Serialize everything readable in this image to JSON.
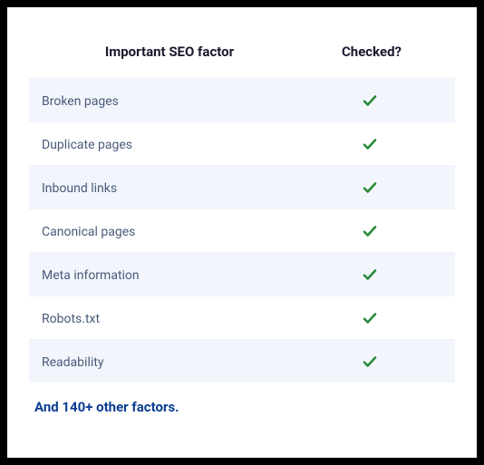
{
  "header": {
    "factor_label": "Important SEO factor",
    "checked_label": "Checked?"
  },
  "rows": [
    {
      "label": "Broken pages",
      "checked": true
    },
    {
      "label": "Duplicate pages",
      "checked": true
    },
    {
      "label": "Inbound links",
      "checked": true
    },
    {
      "label": "Canonical pages",
      "checked": true
    },
    {
      "label": "Meta information",
      "checked": true
    },
    {
      "label": "Robots.txt",
      "checked": true
    },
    {
      "label": "Readability",
      "checked": true
    }
  ],
  "footer_note": "And 140+ other factors.",
  "colors": {
    "check": "#2a8a3a"
  }
}
